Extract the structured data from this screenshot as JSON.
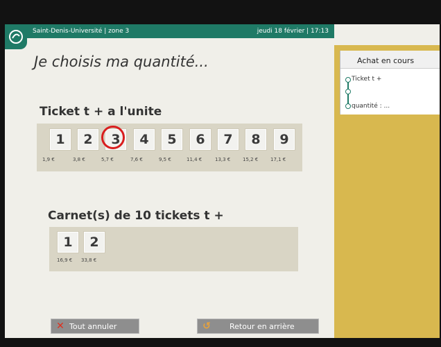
{
  "header": {
    "location": "Saint-Denis-Université | zone 3",
    "datetime": "jeudi 18 février | 17:13"
  },
  "heading": "Je choisis ma quantité...",
  "sidebar": {
    "title": "Achat en cours",
    "step1": "Ticket t +",
    "step2": "quantité : ..."
  },
  "single": {
    "title": "Ticket t + a l'unite",
    "options": [
      {
        "qty": "1",
        "price": "1,9 €"
      },
      {
        "qty": "2",
        "price": "3,8 €"
      },
      {
        "qty": "3",
        "price": "5,7 €"
      },
      {
        "qty": "4",
        "price": "7,6 €"
      },
      {
        "qty": "5",
        "price": "9,5 €"
      },
      {
        "qty": "6",
        "price": "11,4 €"
      },
      {
        "qty": "7",
        "price": "13,3 €"
      },
      {
        "qty": "8",
        "price": "15,2 €"
      },
      {
        "qty": "9",
        "price": "17,1 €"
      }
    ],
    "highlighted": "3"
  },
  "carnet": {
    "title": "Carnet(s) de 10 tickets t +",
    "options": [
      {
        "qty": "1",
        "price": "16,9 €"
      },
      {
        "qty": "2",
        "price": "33,8 €"
      }
    ]
  },
  "footer": {
    "cancel_label": "Tout annuler",
    "back_label": "Retour en arrière"
  },
  "colors": {
    "brand": "#1f7a66",
    "highlight": "#d91e1e",
    "side": "#d8b84f"
  }
}
